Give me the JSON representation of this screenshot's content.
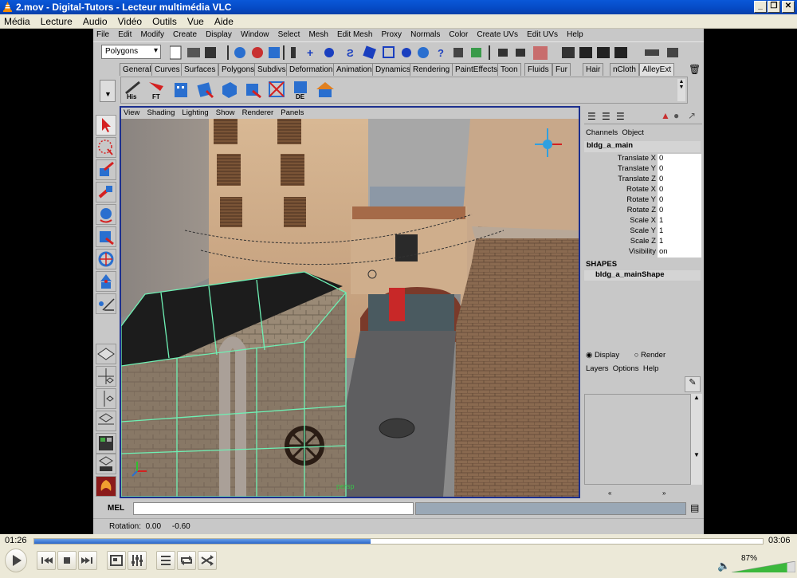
{
  "window": {
    "title": "2.mov - Digital-Tutors - Lecteur multimédia VLC"
  },
  "vlc_menu": [
    "Média",
    "Lecture",
    "Audio",
    "Vidéo",
    "Outils",
    "Vue",
    "Aide"
  ],
  "maya": {
    "menu": [
      "File",
      "Edit",
      "Modify",
      "Create",
      "Display",
      "Window",
      "Select",
      "Mesh",
      "Edit Mesh",
      "Proxy",
      "Normals",
      "Color",
      "Create UVs",
      "Edit UVs",
      "Help"
    ],
    "mode_selector": "Polygons",
    "shelf_tabs": [
      "General",
      "Curves",
      "Surfaces",
      "Polygons",
      "Subdivs",
      "Deformation",
      "Animation",
      "Dynamics",
      "Rendering",
      "PaintEffects",
      "Toon",
      "Fluids",
      "Fur",
      "Hair",
      "nCloth",
      "AlleyExt"
    ],
    "active_shelf_tab": "AlleyExt",
    "shelf_buttons": [
      "His",
      "FT",
      "",
      "",
      "",
      "",
      "DE",
      ""
    ],
    "viewport_menu": [
      "View",
      "Shading",
      "Lighting",
      "Show",
      "Renderer",
      "Panels"
    ],
    "camera_label": "persp",
    "channel_box": {
      "tabs": [
        "Channels",
        "Object"
      ],
      "object_name": "bldg_a_main",
      "attributes": [
        {
          "label": "Translate X",
          "value": "0"
        },
        {
          "label": "Translate Y",
          "value": "0"
        },
        {
          "label": "Translate Z",
          "value": "0"
        },
        {
          "label": "Rotate X",
          "value": "0"
        },
        {
          "label": "Rotate Y",
          "value": "0"
        },
        {
          "label": "Rotate Z",
          "value": "0"
        },
        {
          "label": "Scale X",
          "value": "1"
        },
        {
          "label": "Scale Y",
          "value": "1"
        },
        {
          "label": "Scale Z",
          "value": "1"
        },
        {
          "label": "Visibility",
          "value": "on"
        }
      ],
      "shapes_heading": "SHAPES",
      "shape_name": "bldg_a_mainShape"
    },
    "layer_editor": {
      "display_label": "Display",
      "render_label": "Render",
      "menu": [
        "Layers",
        "Options",
        "Help"
      ]
    },
    "mel_label": "MEL",
    "help_line": "Rotation:  0.00     -0.60"
  },
  "player": {
    "elapsed": "01:26",
    "duration": "03:06",
    "progress": 0.462,
    "volume_label": "87%",
    "volume": 0.87
  },
  "colors": {
    "accent": "#1c2f8e",
    "selection": "#6ef0b4",
    "progress": "#3d7ad6"
  }
}
